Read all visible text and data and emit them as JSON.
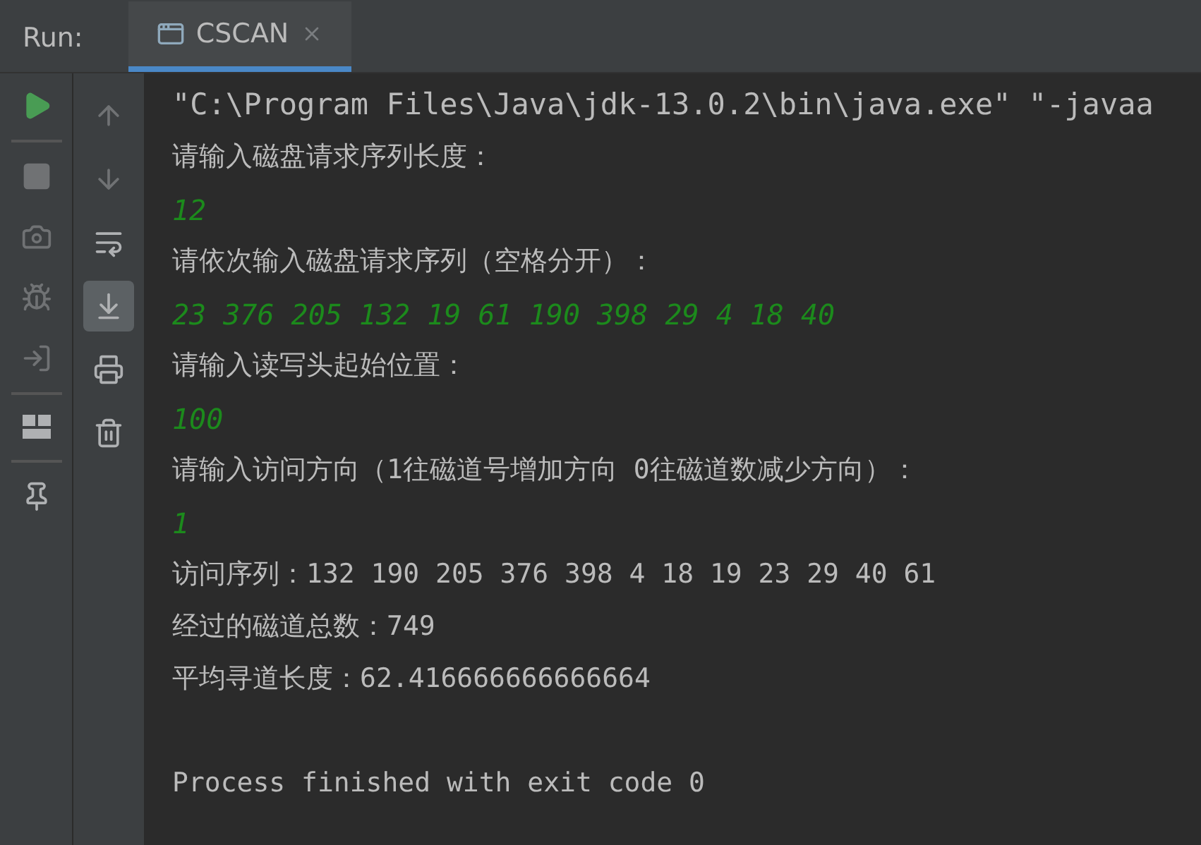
{
  "header": {
    "label": "Run:",
    "tab": {
      "title": "CSCAN",
      "selected": true
    }
  },
  "left_toolbar": [
    {
      "kind": "play",
      "disabled": false
    },
    {
      "kind": "separator"
    },
    {
      "kind": "stop",
      "disabled": true
    },
    {
      "kind": "camera",
      "disabled": true
    },
    {
      "kind": "bug",
      "disabled": true
    },
    {
      "kind": "exit",
      "disabled": true
    },
    {
      "kind": "separator"
    },
    {
      "kind": "layout",
      "disabled": false
    },
    {
      "kind": "separator"
    },
    {
      "kind": "pin",
      "disabled": false
    }
  ],
  "right_toolbar": [
    {
      "kind": "up",
      "disabled": true,
      "selected": false
    },
    {
      "kind": "down",
      "disabled": true,
      "selected": false
    },
    {
      "kind": "wrap",
      "disabled": false,
      "selected": false
    },
    {
      "kind": "scroll-end",
      "disabled": false,
      "selected": true
    },
    {
      "kind": "print",
      "disabled": false,
      "selected": false
    },
    {
      "kind": "trash",
      "disabled": false,
      "selected": false
    }
  ],
  "console": [
    {
      "kind": "command",
      "text": "\"C:\\Program Files\\Java\\jdk-13.0.2\\bin\\java.exe\" \"-javaa"
    },
    {
      "kind": "output",
      "text": "请输入磁盘请求序列长度："
    },
    {
      "kind": "input",
      "text": "12"
    },
    {
      "kind": "output",
      "text": "请依次输入磁盘请求序列（空格分开）："
    },
    {
      "kind": "input",
      "text": "23 376 205 132 19 61 190 398 29 4 18 40"
    },
    {
      "kind": "output",
      "text": "请输入读写头起始位置："
    },
    {
      "kind": "input",
      "text": "100"
    },
    {
      "kind": "output",
      "text": "请输入访问方向（1往磁道号增加方向 0往磁道数减少方向）："
    },
    {
      "kind": "input",
      "text": "1"
    },
    {
      "kind": "output",
      "text": "访问序列：132 190 205 376 398 4 18 19 23 29 40 61"
    },
    {
      "kind": "output",
      "text": "经过的磁道总数：749"
    },
    {
      "kind": "output",
      "text": "平均寻道长度：62.416666666666664"
    },
    {
      "kind": "blank"
    },
    {
      "kind": "output",
      "text": "Process finished with exit code 0"
    }
  ]
}
